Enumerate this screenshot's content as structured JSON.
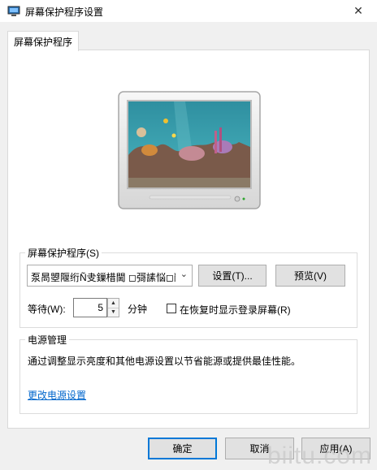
{
  "window": {
    "title": "屏幕保护程序设置",
    "close_glyph": "✕"
  },
  "tabs": [
    {
      "label": "屏幕保护程序"
    }
  ],
  "screensaver": {
    "group_label": "屏幕保护程序(S)",
    "selected": "泵晑曌隁绗Ñ叏鏁棤閫 ◻彁䛾悩◻敞",
    "settings_button": "设置(T)...",
    "preview_button": "预览(V)",
    "wait_label": "等待(W):",
    "wait_value": "5",
    "wait_unit": "分钟",
    "resume_checkbox_label": "在恢复时显示登录屏幕(R)",
    "resume_checked": false
  },
  "power": {
    "group_label": "电源管理",
    "description": "通过调整显示亮度和其他电源设置以节省能源或提供最佳性能。",
    "link_text": "更改电源设置"
  },
  "footer": {
    "ok": "确定",
    "cancel": "取消",
    "apply": "应用(A)"
  },
  "watermark": "biitu.com",
  "colors": {
    "link": "#0066cc",
    "focus_border": "#0078d7",
    "window_bg": "#f0f0f0"
  }
}
